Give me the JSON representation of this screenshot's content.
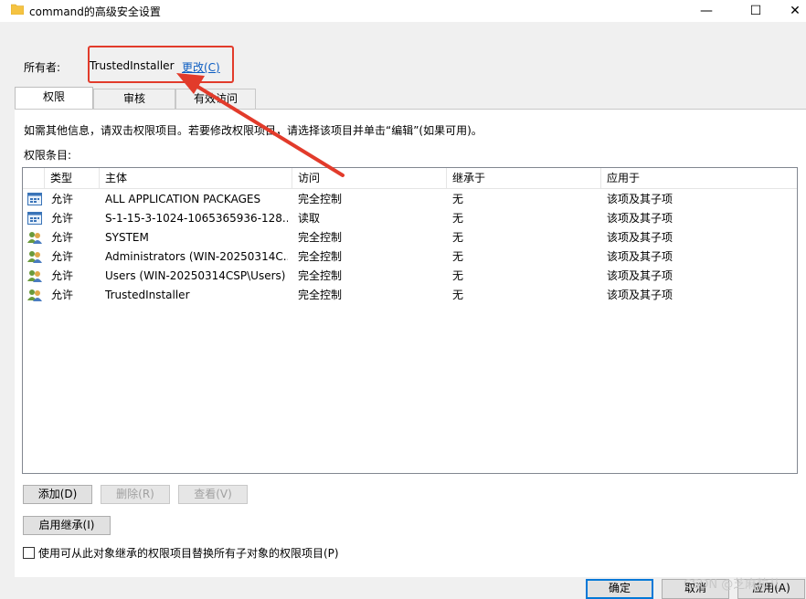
{
  "window": {
    "title": "command的高级安全设置",
    "minimize": "—",
    "maximize": "☐",
    "close": "✕"
  },
  "owner": {
    "label": "所有者:",
    "value": "TrustedInstaller",
    "change_link": "更改(C)"
  },
  "tabs": [
    {
      "label": "权限",
      "active": true
    },
    {
      "label": "审核",
      "active": false
    },
    {
      "label": "有效访问",
      "active": false
    }
  ],
  "info_text": "如需其他信息，请双击权限项目。若要修改权限项目，请选择该项目并单击“编辑”(如果可用)。",
  "entries_label": "权限条目:",
  "table": {
    "headers": [
      "类型",
      "主体",
      "访问",
      "继承于",
      "应用于"
    ],
    "rows": [
      {
        "icon": "app-package-icon",
        "type": "允许",
        "principal": "ALL APPLICATION PACKAGES",
        "access": "完全控制",
        "inherited": "无",
        "applies": "该项及其子项"
      },
      {
        "icon": "app-package-icon",
        "type": "允许",
        "principal": "S-1-15-3-1024-1065365936-128...",
        "access": "读取",
        "inherited": "无",
        "applies": "该项及其子项"
      },
      {
        "icon": "user-group-icon",
        "type": "允许",
        "principal": "SYSTEM",
        "access": "完全控制",
        "inherited": "无",
        "applies": "该项及其子项"
      },
      {
        "icon": "user-group-icon",
        "type": "允许",
        "principal": "Administrators (WIN-20250314C...",
        "access": "完全控制",
        "inherited": "无",
        "applies": "该项及其子项"
      },
      {
        "icon": "user-group-icon",
        "type": "允许",
        "principal": "Users (WIN-20250314CSP\\Users)",
        "access": "完全控制",
        "inherited": "无",
        "applies": "该项及其子项"
      },
      {
        "icon": "user-group-icon",
        "type": "允许",
        "principal": "TrustedInstaller",
        "access": "完全控制",
        "inherited": "无",
        "applies": "该项及其子项"
      }
    ]
  },
  "buttons": {
    "add": "添加(D)",
    "remove": "删除(R)",
    "view": "查看(V)",
    "enable_inheritance": "启用继承(I)",
    "ok": "确定",
    "cancel": "取消",
    "apply": "应用(A)"
  },
  "replace_checkbox_label": "使用可从此对象继承的权限项目替换所有子对象的权限项目(P)",
  "watermark": "CSDN @芝麻粒儿",
  "colors": {
    "annotation_red": "#e23b2b",
    "link_blue": "#0b5cc1",
    "primary_button_border": "#0078d7"
  }
}
